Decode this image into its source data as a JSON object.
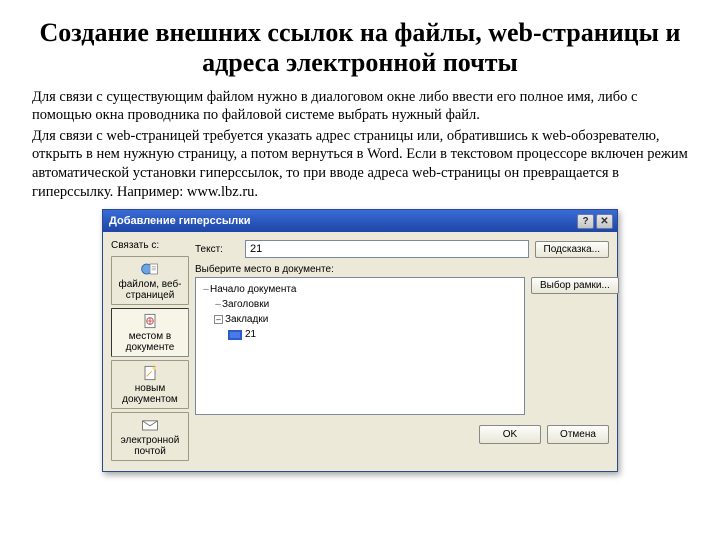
{
  "heading": "Создание внешних ссылок на файлы, web-страницы и адреса электронной почты",
  "para1": "Для связи с существующим файлом нужно в диалоговом окне либо ввести его полное имя, либо с помощью окна проводника по файловой системе выбрать нужный файл.",
  "para2": "Для связи с web-страницей требуется указать адрес страницы или, обратившись к web-обозревателю, открыть в нем нужную страницу, а потом вернуться в Word. Если в текстовом процессоре включен режим автоматической установки гиперссылок, то при вводе адреса web-страницы он превращается в гиперссылку. Например: www.lbz.ru.",
  "dialog": {
    "title": "Добавление гиперссылки",
    "linkto_label": "Связать с:",
    "sidebar": {
      "file_web": "файлом, веб-страницей",
      "place_in_doc": "местом в документе",
      "new_doc": "новым документом",
      "email": "электронной почтой"
    },
    "text_label": "Текст:",
    "text_value": "21",
    "tooltip_btn": "Подсказка...",
    "tree_label": "Выберите место в документе:",
    "tree": {
      "n0": "Начало документа",
      "n1": "Заголовки",
      "n2": "Закладки",
      "n2a": "21"
    },
    "target_frame_btn": "Выбор рамки...",
    "ok": "OK",
    "cancel": "Отмена"
  }
}
